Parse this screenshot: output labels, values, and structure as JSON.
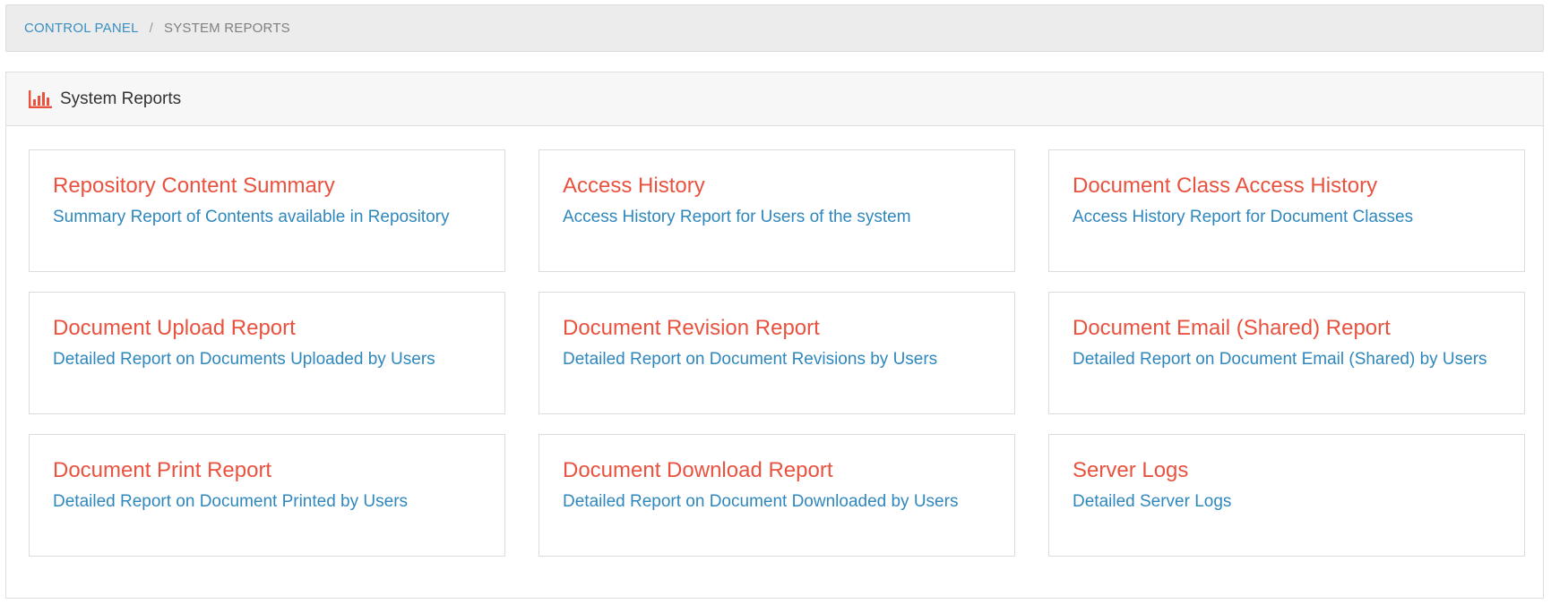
{
  "breadcrumb": {
    "home": "CONTROL PANEL",
    "separator": "/",
    "current": "SYSTEM REPORTS"
  },
  "panel": {
    "icon": "bar-chart-icon",
    "title": "System Reports"
  },
  "colors": {
    "accent_red": "#e8523f",
    "link_blue": "#2e87bd"
  },
  "reports": [
    {
      "title": "Repository Content Summary",
      "description": "Summary Report of Contents available in Repository"
    },
    {
      "title": "Access History",
      "description": "Access History Report for Users of the system"
    },
    {
      "title": "Document Class Access History",
      "description": "Access History Report for Document Classes"
    },
    {
      "title": "Document Upload Report",
      "description": "Detailed Report on Documents Uploaded by Users"
    },
    {
      "title": "Document Revision Report",
      "description": "Detailed Report on Document Revisions by Users"
    },
    {
      "title": "Document Email (Shared) Report",
      "description": "Detailed Report on Document Email (Shared) by Users"
    },
    {
      "title": "Document Print Report",
      "description": "Detailed Report on Document Printed by Users"
    },
    {
      "title": "Document Download Report",
      "description": "Detailed Report on Document Downloaded by Users"
    },
    {
      "title": "Server Logs",
      "description": "Detailed Server Logs"
    }
  ]
}
